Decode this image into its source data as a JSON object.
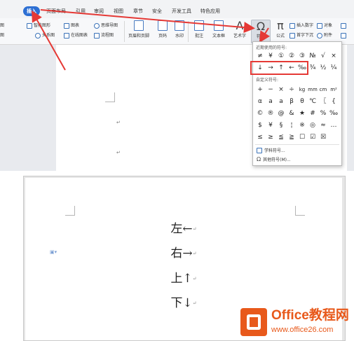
{
  "tabs": [
    {
      "label": "插入",
      "active": true
    },
    {
      "label": "页面布局"
    },
    {
      "label": "引用"
    },
    {
      "label": "审阅"
    },
    {
      "label": "视图"
    },
    {
      "label": "章节"
    },
    {
      "label": "安全"
    },
    {
      "label": "开发工具"
    },
    {
      "label": "特色应用"
    }
  ],
  "toolbar": {
    "smart_shape": "智能图形",
    "chart": "图表",
    "mindmap": "思维导图",
    "relation_chart": "关系图",
    "online_chart": "在线图表",
    "flowchart": "流程图",
    "header_footer": "页眉和页脚",
    "page_number": "页码",
    "watermark": "水印",
    "comment": "批注",
    "textbox": "文本框",
    "wordart": "艺术字",
    "symbol": "符号",
    "formula": "公式",
    "insert_number": "插入数字",
    "object": "对象",
    "drop_cap": "首字下沉",
    "attachment": "附件",
    "left_cut_1": "图",
    "left_cut_2": "图"
  },
  "symbol_popup": {
    "recent_header": "近期使用的符号:",
    "recent_row1": [
      "≠",
      "¥",
      "①",
      "②",
      "③",
      "№",
      "√",
      "×"
    ],
    "recent_row2": [
      "↓",
      "→",
      "↑",
      "←",
      "‰",
      "¾",
      "½",
      "¼"
    ],
    "custom_header": "自定义符号:",
    "custom_rows": [
      [
        "+",
        "−",
        "×",
        "÷",
        "kg",
        "mm",
        "cm",
        "m²"
      ],
      [
        "α",
        "a",
        "a",
        "β",
        "θ",
        "℃",
        "〖",
        "{"
      ],
      [
        "©",
        "®",
        "@",
        "&",
        "★",
        "#",
        "%",
        "‰"
      ],
      [
        "$",
        "¥",
        "§",
        "¦",
        "※",
        "◎",
        "≈",
        "…"
      ],
      [
        "≤",
        "≥",
        "≦",
        "≧",
        "☐",
        "☑",
        "☒",
        ""
      ]
    ],
    "subject_symbols": "学科符号...",
    "other_symbols": "其他符号(M)..."
  },
  "document": {
    "para_mark": "↵",
    "lines": [
      "左←",
      "右→",
      "上↑",
      "下↓"
    ]
  },
  "watermark": {
    "title": "Office教程网",
    "url": "www.office26.com"
  },
  "colors": {
    "accent_blue": "#2d6fd3",
    "annotation_red": "#e53935",
    "brand_orange": "#e8591b"
  }
}
